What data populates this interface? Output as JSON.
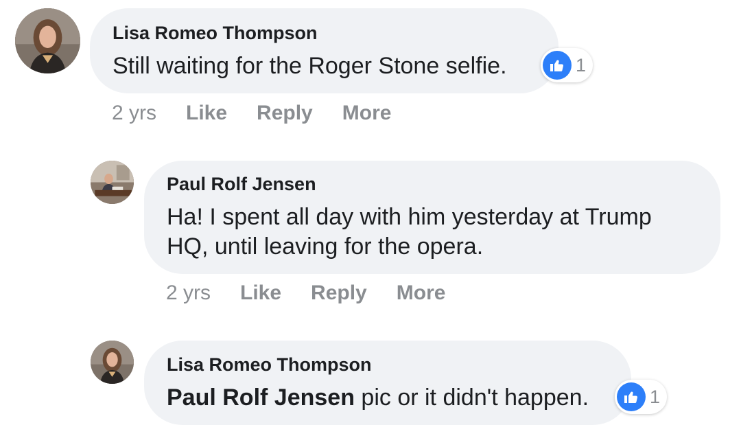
{
  "comments": [
    {
      "author": "Lisa Romeo Thompson",
      "text": "Still waiting for the Roger Stone selfie.",
      "reactions": {
        "icon": "like-icon",
        "count": "1"
      },
      "time": "2 yrs",
      "actions": {
        "like": "Like",
        "reply": "Reply",
        "more": "More"
      }
    },
    {
      "author": "Paul Rolf Jensen",
      "text_line1": "Ha! I spent all day with him yesterday at Trump",
      "text_line2": "HQ, until leaving for the opera.",
      "time": "2 yrs",
      "actions": {
        "like": "Like",
        "reply": "Reply",
        "more": "More"
      }
    },
    {
      "author": "Lisa Romeo Thompson",
      "mention": "Paul Rolf Jensen",
      "text": " pic or it didn't happen.",
      "reactions": {
        "icon": "like-icon",
        "count": "1"
      },
      "time": "",
      "actions": {}
    }
  ],
  "colors": {
    "bubble": "#f0f2f5",
    "like_blue": "#2d7ff9",
    "meta_gray": "#8a8d91",
    "text": "#1c1e21"
  }
}
